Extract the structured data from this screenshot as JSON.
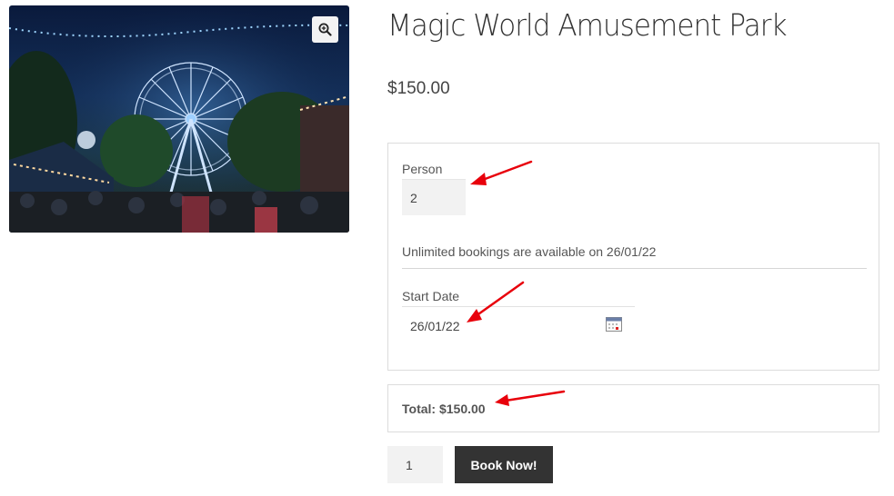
{
  "product": {
    "title": "Magic World Amusement Park",
    "price": "$150.00"
  },
  "booking": {
    "person_label": "Person",
    "person_value": "2",
    "availability_text": "Unlimited bookings are available on 26/01/22",
    "start_date_label": "Start Date",
    "start_date_value": "26/01/22"
  },
  "total": {
    "text": "Total: $150.00"
  },
  "cart": {
    "quantity": "1",
    "book_label": "Book Now!"
  },
  "icons": {
    "zoom": "zoom-in-icon",
    "calendar": "calendar-icon"
  },
  "colors": {
    "button_bg": "#333333",
    "annotation_arrow": "#e8000b",
    "input_bg": "#f2f2f2"
  }
}
